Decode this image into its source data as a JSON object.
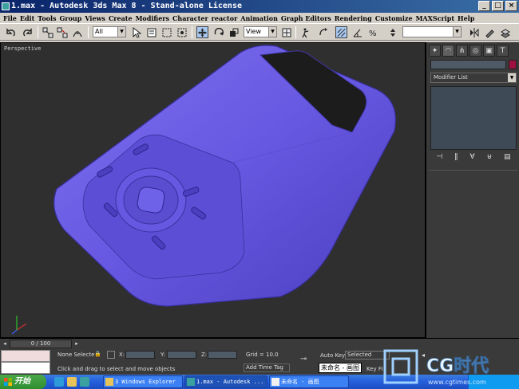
{
  "window": {
    "title": "1.max - Autodesk 3ds Max 8  - Stand-alone License",
    "minimize": "_",
    "maximize": "□",
    "close": "×"
  },
  "menu": [
    "File",
    "Edit",
    "Tools",
    "Group",
    "Views",
    "Create",
    "Modifiers",
    "Character",
    "reactor",
    "Animation",
    "Graph Editors",
    "Rendering",
    "Customize",
    "MAXScript",
    "Help"
  ],
  "toolbar": {
    "selection_filter": "All",
    "ref_coord": "View"
  },
  "viewport": {
    "label": "Perspective",
    "object_color": "#6a5ce0",
    "background": "#2f2f2f"
  },
  "command_panel": {
    "modifier_list": "Modifier List",
    "object_color": "#a01040"
  },
  "timeslider": {
    "frame": "0 / 100"
  },
  "status": {
    "selection": "None Selecte",
    "x_label": "X:",
    "y_label": "Y:",
    "z_label": "Z:",
    "grid": "Grid = 10.0",
    "prompt": "Click and drag to select and move objects",
    "add_time_tag": "Add Time Tag",
    "auto_key": "Auto Key",
    "auto_key_mode": "Selected",
    "key_filters": "Key Fi"
  },
  "taskbar": {
    "start": "开始",
    "tasks": [
      "3 Windows Explorer",
      "1.max - Autodesk ...",
      "未命名 - 画图"
    ],
    "tooltip": "未命名 - 画图"
  },
  "watermark": {
    "text": "CG时代",
    "url": "www.cgtimes.com"
  }
}
